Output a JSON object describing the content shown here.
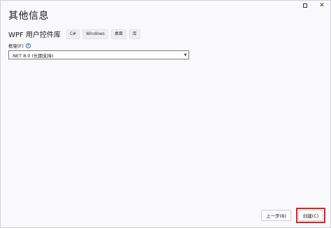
{
  "window": {
    "minimize_icon": "minimize-icon",
    "maximize_icon": "maximize-icon",
    "close_label": "✕",
    "close_icon": "close-icon"
  },
  "page": {
    "title": "其他信息"
  },
  "template": {
    "name": "WPF 用户控件库",
    "tags": [
      "C#",
      "Windows",
      "桌面",
      "库"
    ]
  },
  "framework": {
    "label": "框架(F)",
    "info_label": "i",
    "value": ".NET 8.0 (长期支持)",
    "dropdown_arrow": "▼"
  },
  "footer": {
    "back_label": "上一步(B)",
    "create_label": "创建(C)"
  },
  "colors": {
    "highlight": "#e02020",
    "info": "#1a73d9"
  }
}
